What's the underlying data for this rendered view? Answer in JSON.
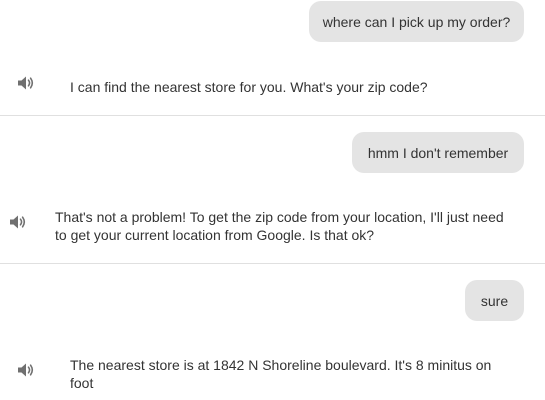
{
  "conversation": [
    {
      "role": "user",
      "text": "where can I pick up my order?"
    },
    {
      "role": "bot",
      "text": "I can find the nearest store for you. What's your zip code?",
      "icon": "speaker-icon"
    },
    {
      "role": "user",
      "text": "hmm I don't remember"
    },
    {
      "role": "bot",
      "text": "That's not a problem! To get the zip code from your location, I'll just need to get your current location from Google. Is that ok?",
      "icon": "speaker-icon"
    },
    {
      "role": "user",
      "text": "sure"
    },
    {
      "role": "bot",
      "text": "The nearest store is at 1842 N Shoreline boulevard. It's 8 minitus on foot",
      "icon": "speaker-icon"
    }
  ],
  "colors": {
    "user_bubble": "#e4e4e4",
    "divider": "#e0e0e0",
    "icon": "#707070",
    "text": "#333333"
  }
}
